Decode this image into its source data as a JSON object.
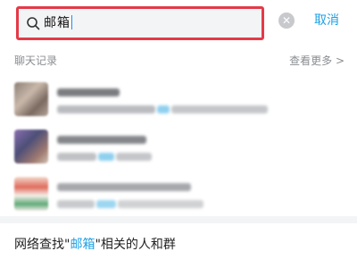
{
  "search": {
    "query": "邮箱"
  },
  "cancel_label": "取消",
  "chat_section": {
    "title": "聊天记录",
    "view_more": "查看更多 >"
  },
  "colors": {
    "accent": "#1ba0e6",
    "highlight_border": "#e43a48"
  },
  "results": [
    {
      "blurred": true
    },
    {
      "blurred": true
    },
    {
      "blurred": true
    }
  ],
  "network_search": {
    "prefix": "网络查找\"",
    "keyword": "邮箱",
    "suffix": "\"相关的人和群"
  }
}
